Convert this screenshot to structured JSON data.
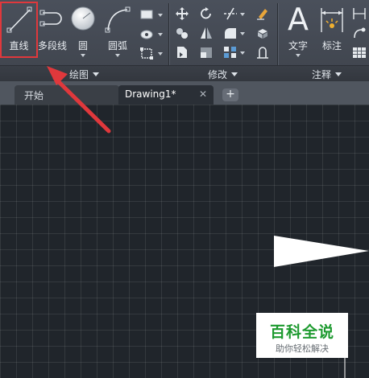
{
  "ribbon": {
    "draw_panel": {
      "label": "绘图",
      "tools": [
        {
          "label": "直线",
          "icon": "line-icon"
        },
        {
          "label": "多段线",
          "icon": "polyline-icon"
        },
        {
          "label": "圆",
          "icon": "circle-icon"
        },
        {
          "label": "圆弧",
          "icon": "arc-icon"
        }
      ],
      "small_tools": [
        "rectangle-icon",
        "hatch-icon",
        "region-icon"
      ]
    },
    "modify_panel": {
      "label": "修改",
      "small_tools": [
        "move-icon",
        "rotate-icon",
        "trim-icon",
        "erase-icon",
        "copy-icon",
        "mirror-icon",
        "fillet-icon",
        "explode-icon",
        "stretch-icon",
        "scale-icon",
        "array-icon",
        "offset-icon"
      ]
    },
    "annotate_panel": {
      "label": "注释",
      "tools": [
        {
          "label": "文字",
          "icon": "text-icon",
          "glyph": "A"
        },
        {
          "label": "标注",
          "icon": "dimension-icon"
        }
      ],
      "small_tools": [
        "linear-dim-icon",
        "leader-icon",
        "table-icon"
      ]
    }
  },
  "tabs": [
    {
      "label": "开始",
      "active": false
    },
    {
      "label": "Drawing1*",
      "active": true,
      "close": "✕"
    }
  ],
  "tab_add_label": "+",
  "watermark": {
    "title": "百科全说",
    "subtitle": "助你轻松解决"
  },
  "colors": {
    "highlight": "#e0383c",
    "arrow": "#e0383c",
    "canvas_bg": "#20252b",
    "ribbon_bg": "#444a54",
    "watermark_green": "#1d9a2f"
  }
}
